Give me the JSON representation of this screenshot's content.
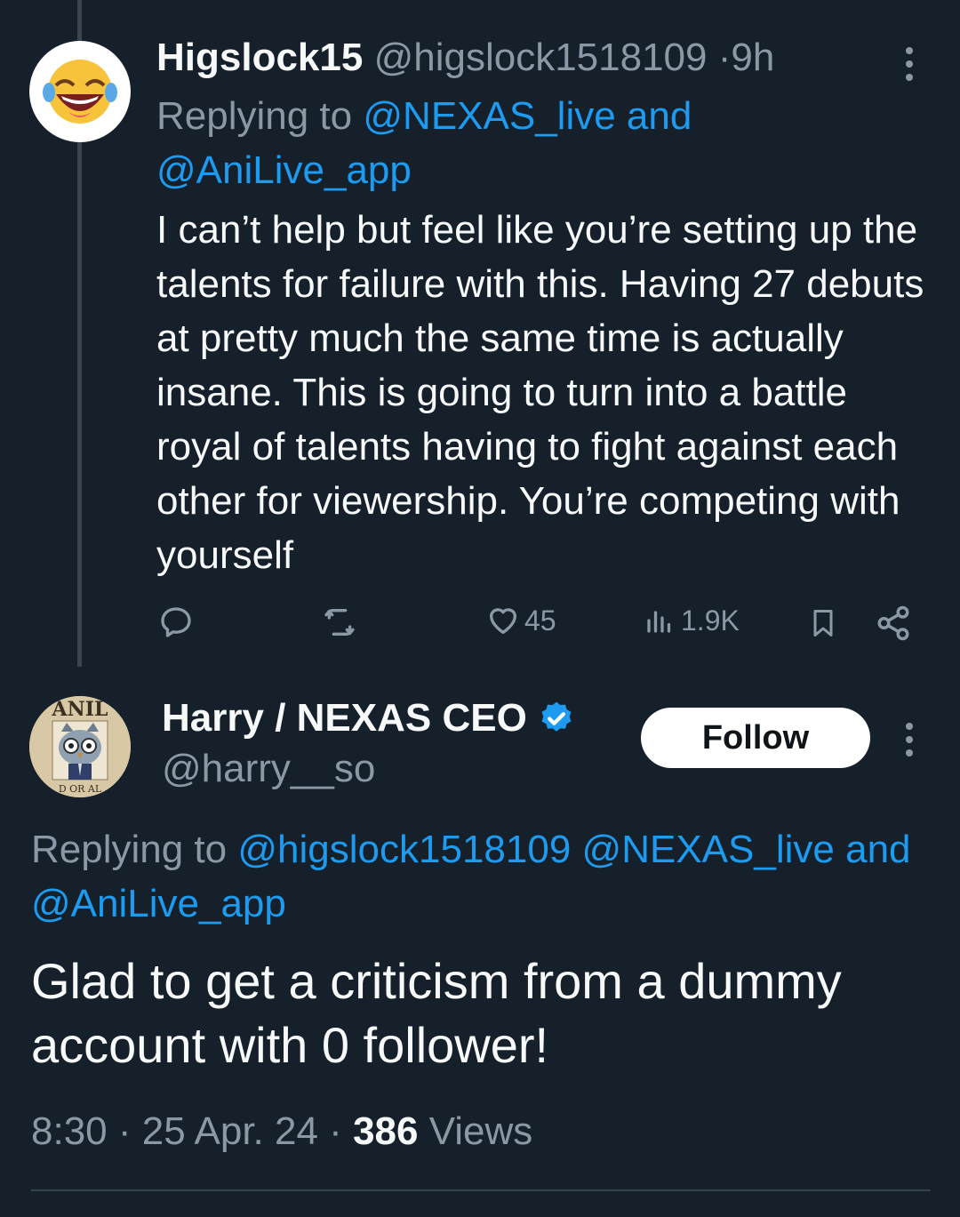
{
  "tweet1": {
    "author_name": "Higslock15",
    "author_handle": "@higslock1518109",
    "separator": "·",
    "time": "9h",
    "replying_prefix": "Replying to",
    "replying_to_1": "@NEXAS_live and",
    "replying_to_2": "@AniLive_app",
    "body": "I can’t help but feel like you’re setting up the talents for failure with this. Having 27 debuts at pretty much the same time is actually insane. This is going to turn into a battle royal of talents having to fight against each other for viewership. You’re competing with yourself",
    "likes": "45",
    "views": "1.9K",
    "avatar_icon": "laughing-crying-emoji-icon"
  },
  "tweet2": {
    "author_name": "Harry / NEXAS CEO",
    "author_handle": "@harry__so",
    "verified_icon": "verified-badge-icon",
    "follow_label": "Follow",
    "replying_prefix": "Replying to",
    "replying_to_1": "@higslock1518109",
    "replying_to_2": "@NEXAS_live and",
    "replying_to_3": "@AniLive_app",
    "body": "Glad to get a criticism from a dummy account with 0 follower!",
    "time": "8:30",
    "sep1": "·",
    "date": "25 Apr. 24",
    "sep2": "·",
    "views_count": "386",
    "views_label": "Views",
    "avatar_text_top": "ANIL",
    "avatar_text_bottom": "D OR AL"
  },
  "colors": {
    "background": "#15202b",
    "accent": "#1d9bf0",
    "muted": "#8b98a5",
    "text": "#f7f9f9"
  }
}
